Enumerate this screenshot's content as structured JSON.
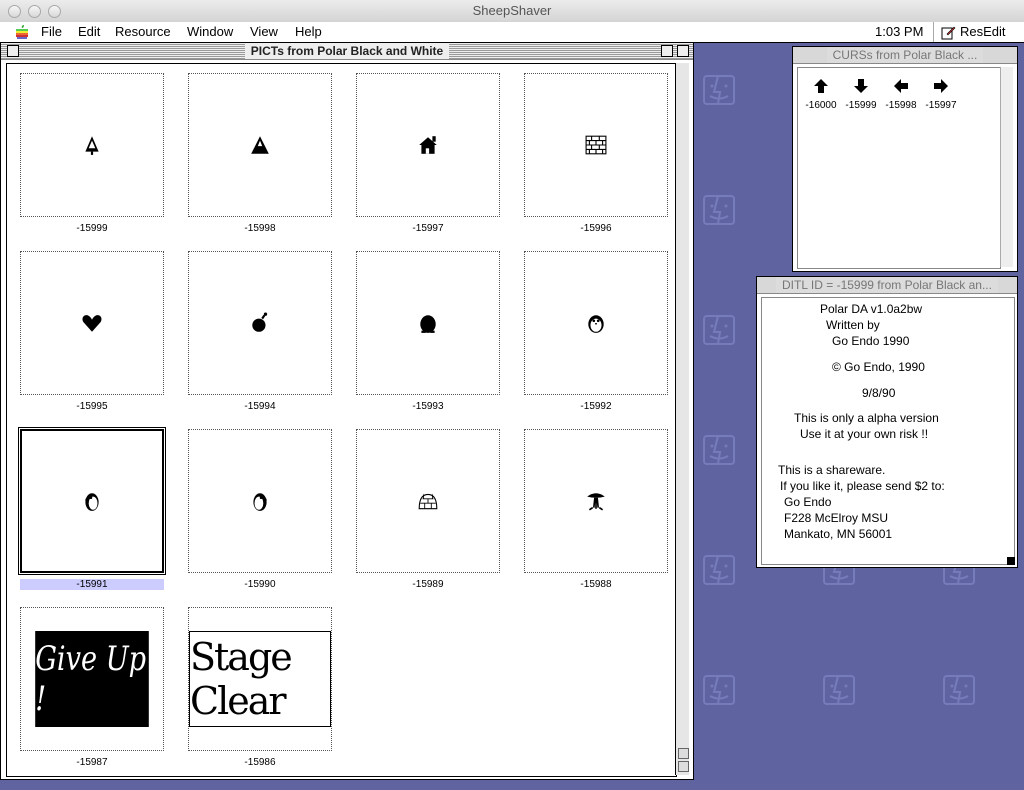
{
  "host": {
    "title": "SheepShaver"
  },
  "menubar": {
    "items": [
      "File",
      "Edit",
      "Resource",
      "Window",
      "View",
      "Help"
    ],
    "clock": "1:03 PM",
    "app_name": "ResEdit"
  },
  "pict_window": {
    "title": "PICTs from Polar Black and White",
    "items": [
      {
        "id": "-15999",
        "icon": "tree-icon"
      },
      {
        "id": "-15998",
        "icon": "mountain-icon"
      },
      {
        "id": "-15997",
        "icon": "house-icon"
      },
      {
        "id": "-15996",
        "icon": "brick-wall-icon"
      },
      {
        "id": "-15995",
        "icon": "heart-icon"
      },
      {
        "id": "-15994",
        "icon": "bomb-icon"
      },
      {
        "id": "-15993",
        "icon": "penguin-silhouette-icon"
      },
      {
        "id": "-15992",
        "icon": "penguin-icon"
      },
      {
        "id": "-15991",
        "icon": "penguin-left-icon",
        "selected": true
      },
      {
        "id": "-15990",
        "icon": "penguin-right-icon"
      },
      {
        "id": "-15989",
        "icon": "igloo-icon"
      },
      {
        "id": "-15988",
        "icon": "explosion-icon"
      },
      {
        "id": "-15987",
        "icon": "give-up-banner",
        "banner_text": "Give Up !"
      },
      {
        "id": "-15986",
        "icon": "stage-clear-banner",
        "banner_text": "Stage Clear"
      }
    ]
  },
  "curs_window": {
    "title": "CURSs from Polar Black ...",
    "items": [
      {
        "id": "-16000",
        "icon": "arrow-up-icon"
      },
      {
        "id": "-15999",
        "icon": "arrow-down-icon"
      },
      {
        "id": "-15998",
        "icon": "arrow-left-icon"
      },
      {
        "id": "-15997",
        "icon": "arrow-right-icon"
      }
    ]
  },
  "ditl_window": {
    "title": "DITL ID = -15999 from Polar Black an...",
    "lines": [
      "Polar DA v1.0a2bw",
      "Written by",
      "Go Endo 1990",
      "© Go Endo, 1990",
      "9/8/90",
      "This is only a alpha version",
      "Use it at your own risk !!",
      "This is a shareware.",
      "If you like it, please send $2 to:",
      "Go Endo",
      "F228 McElroy MSU",
      "Mankato, MN 56001"
    ]
  }
}
